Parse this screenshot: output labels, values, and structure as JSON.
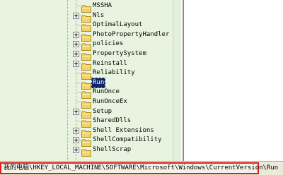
{
  "tree": {
    "items": [
      {
        "label": "MSSHA",
        "expandable": false,
        "selected": false
      },
      {
        "label": "Nls",
        "expandable": true,
        "selected": false
      },
      {
        "label": "OptimalLayout",
        "expandable": false,
        "selected": false
      },
      {
        "label": "PhotoPropertyHandler",
        "expandable": true,
        "selected": false
      },
      {
        "label": "policies",
        "expandable": true,
        "selected": false
      },
      {
        "label": "PropertySystem",
        "expandable": true,
        "selected": false
      },
      {
        "label": "Reinstall",
        "expandable": true,
        "selected": false
      },
      {
        "label": "Reliability",
        "expandable": false,
        "selected": false
      },
      {
        "label": "Run",
        "expandable": false,
        "selected": true
      },
      {
        "label": "RunOnce",
        "expandable": false,
        "selected": false
      },
      {
        "label": "RunOnceEx",
        "expandable": false,
        "selected": false
      },
      {
        "label": "Setup",
        "expandable": true,
        "selected": false
      },
      {
        "label": "SharedDlls",
        "expandable": false,
        "selected": false
      },
      {
        "label": "Shell Extensions",
        "expandable": true,
        "selected": false
      },
      {
        "label": "ShellCompatibility",
        "expandable": true,
        "selected": false
      },
      {
        "label": "ShellScrap",
        "expandable": true,
        "selected": false
      }
    ]
  },
  "status_bar": {
    "path": "我的电脑\\HKEY_LOCAL_MACHINE\\SOFTWARE\\Microsoft\\Windows\\CurrentVersion\\Run"
  },
  "colors": {
    "tree_background": "#e8f4e0",
    "selection": "#0a246a",
    "folder": "#f4d26a",
    "highlight_border": "#e02020"
  }
}
